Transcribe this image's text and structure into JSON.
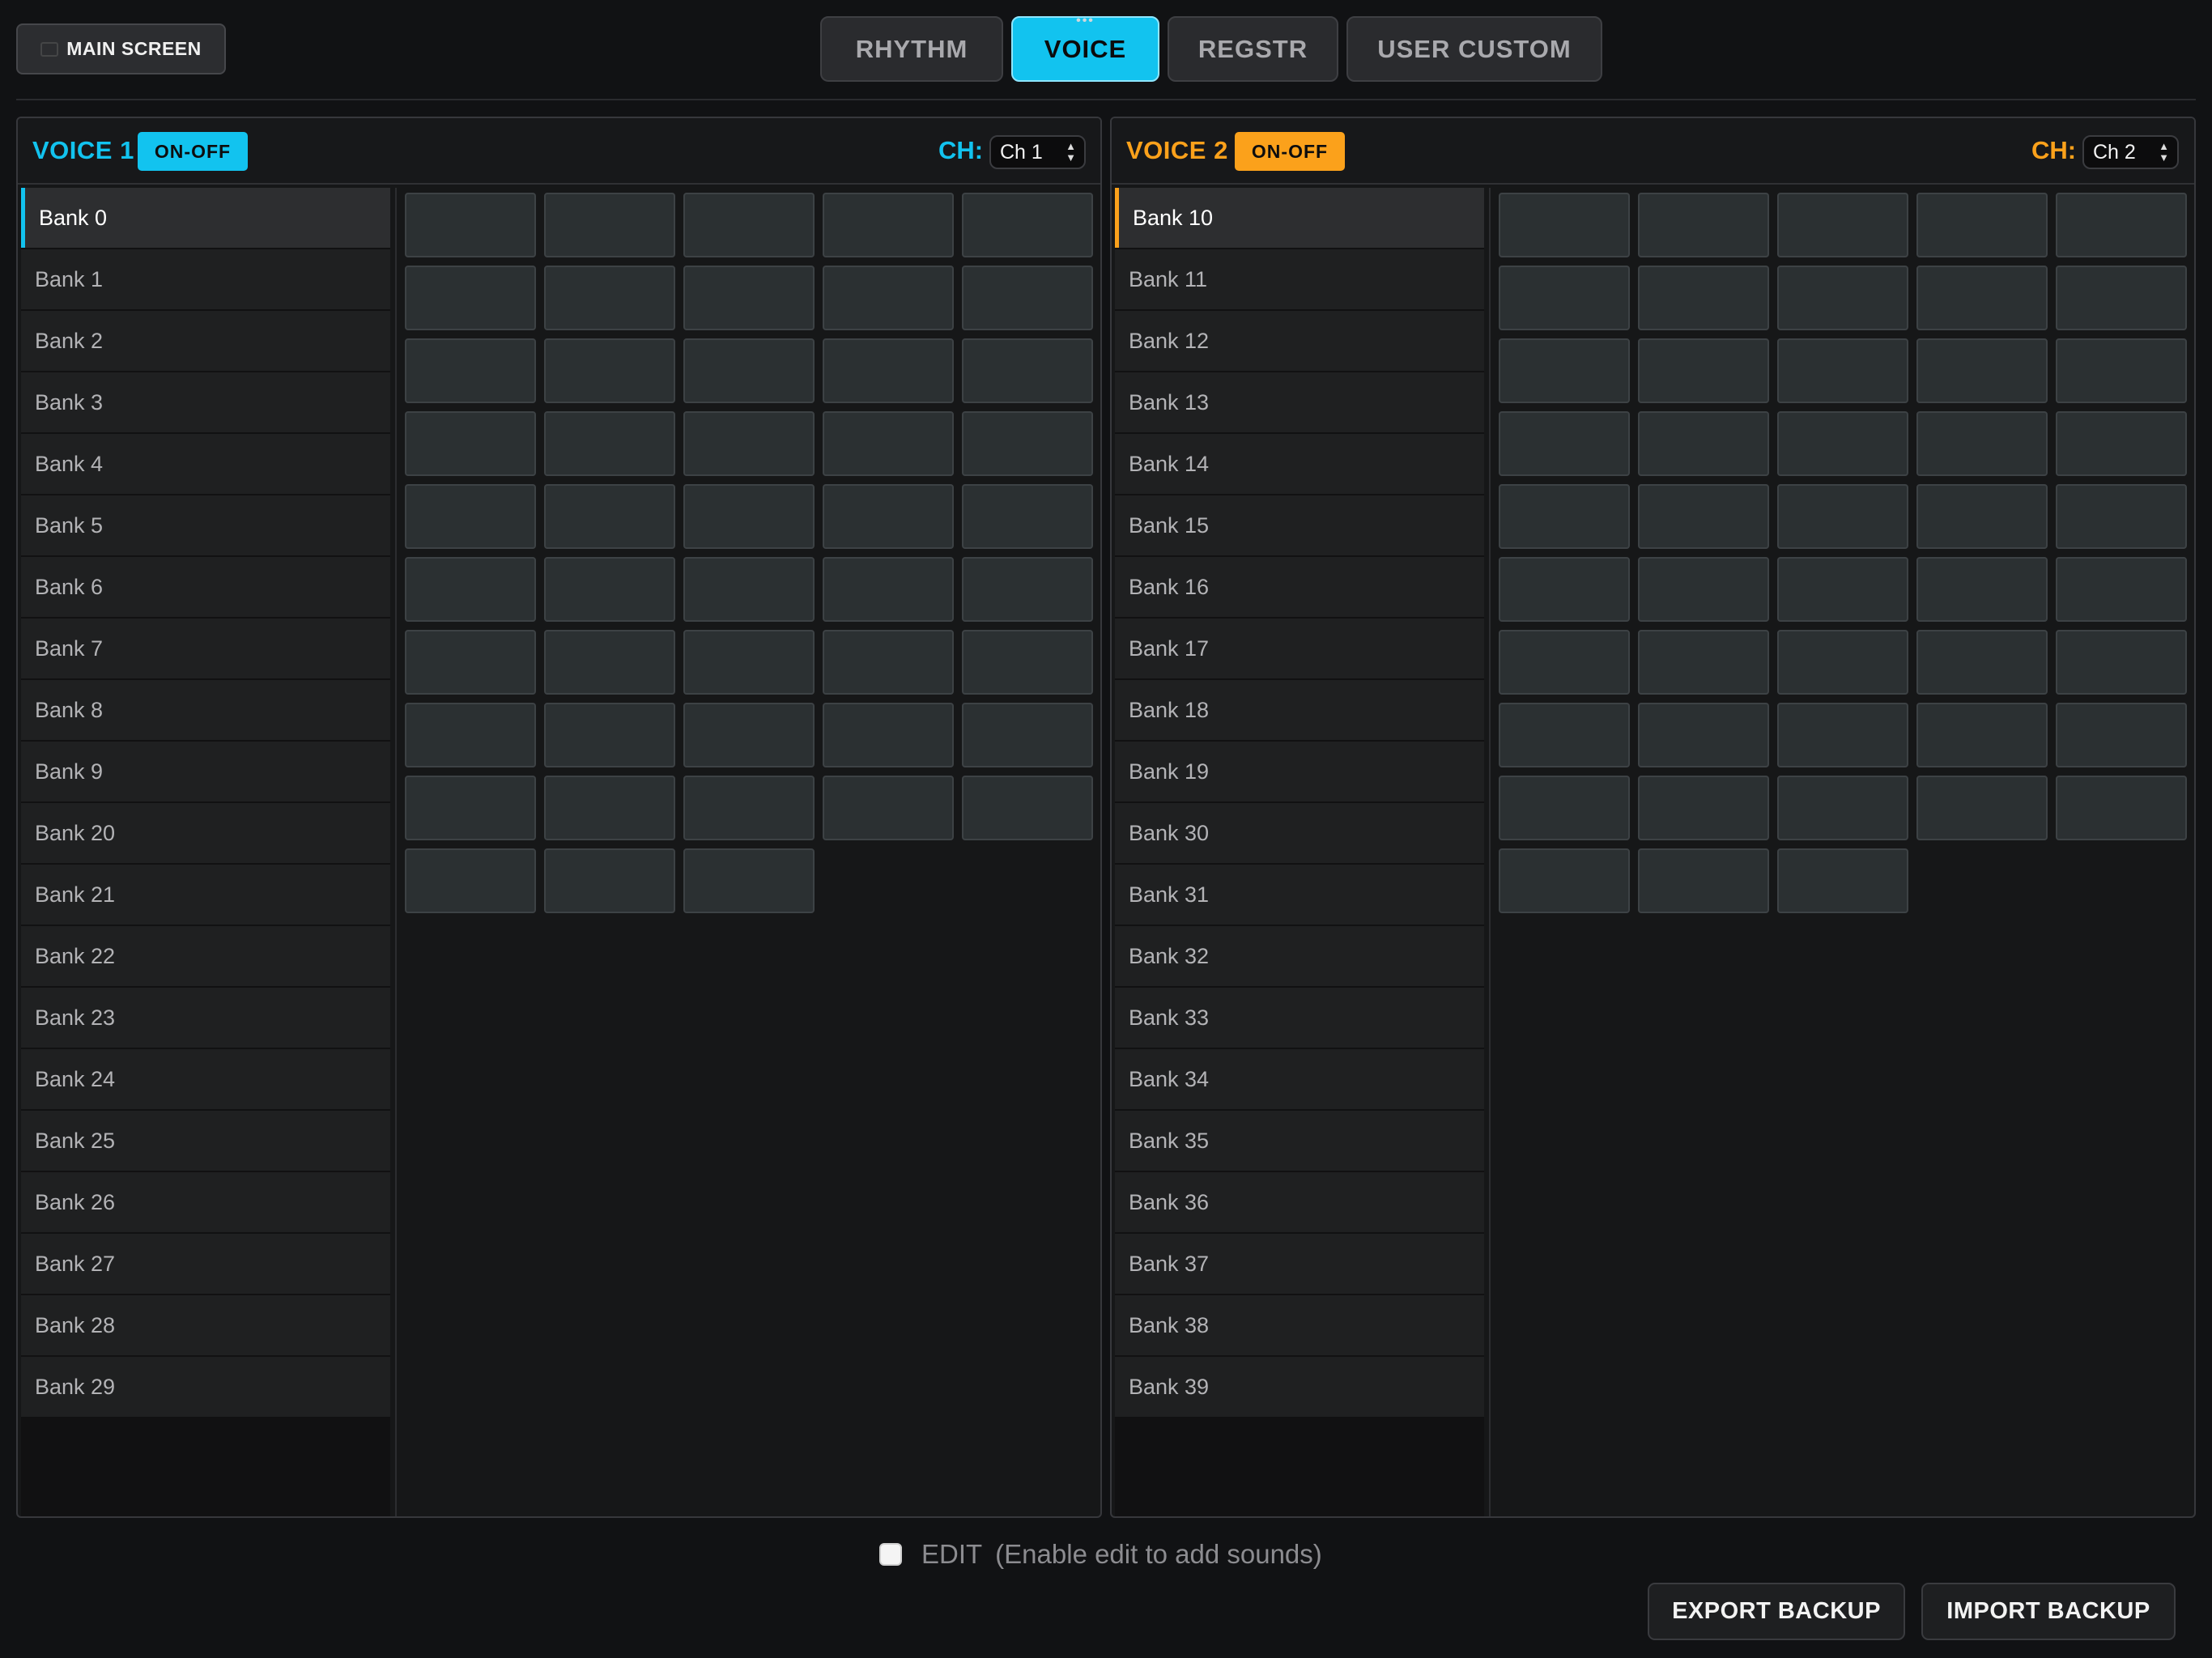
{
  "header": {
    "main_screen_label": "MAIN SCREEN",
    "tabs": [
      {
        "label": "RHYTHM",
        "active": false
      },
      {
        "label": "VOICE",
        "active": true
      },
      {
        "label": "REGSTR",
        "active": false
      },
      {
        "label": "USER CUSTOM",
        "active": false
      }
    ]
  },
  "colors": {
    "voice1_accent": "#12c3ef",
    "voice2_accent": "#fba11b"
  },
  "voice1": {
    "title": "VOICE 1",
    "onoff_label": "ON-OFF",
    "ch_label": "CH:",
    "ch_value": "Ch 1",
    "selected_bank": "Bank 0",
    "banks": [
      "Bank 0",
      "Bank 1",
      "Bank 2",
      "Bank 3",
      "Bank 4",
      "Bank 5",
      "Bank 6",
      "Bank 7",
      "Bank 8",
      "Bank 9",
      "Bank 20",
      "Bank 21",
      "Bank 22",
      "Bank 23",
      "Bank 24",
      "Bank 25",
      "Bank 26",
      "Bank 27",
      "Bank 28",
      "Bank 29"
    ],
    "pad_count": 48
  },
  "voice2": {
    "title": "VOICE 2",
    "onoff_label": "ON-OFF",
    "ch_label": "CH:",
    "ch_value": "Ch 2",
    "selected_bank": "Bank 10",
    "banks": [
      "Bank 10",
      "Bank 11",
      "Bank 12",
      "Bank 13",
      "Bank 14",
      "Bank 15",
      "Bank 16",
      "Bank 17",
      "Bank 18",
      "Bank 19",
      "Bank 30",
      "Bank 31",
      "Bank 32",
      "Bank 33",
      "Bank 34",
      "Bank 35",
      "Bank 36",
      "Bank 37",
      "Bank 38",
      "Bank 39"
    ],
    "pad_count": 48
  },
  "footer": {
    "edit_label": "EDIT",
    "edit_hint": "(Enable edit to add sounds)",
    "edit_checked": false,
    "export_label": "EXPORT BACKUP",
    "import_label": "IMPORT BACKUP"
  }
}
